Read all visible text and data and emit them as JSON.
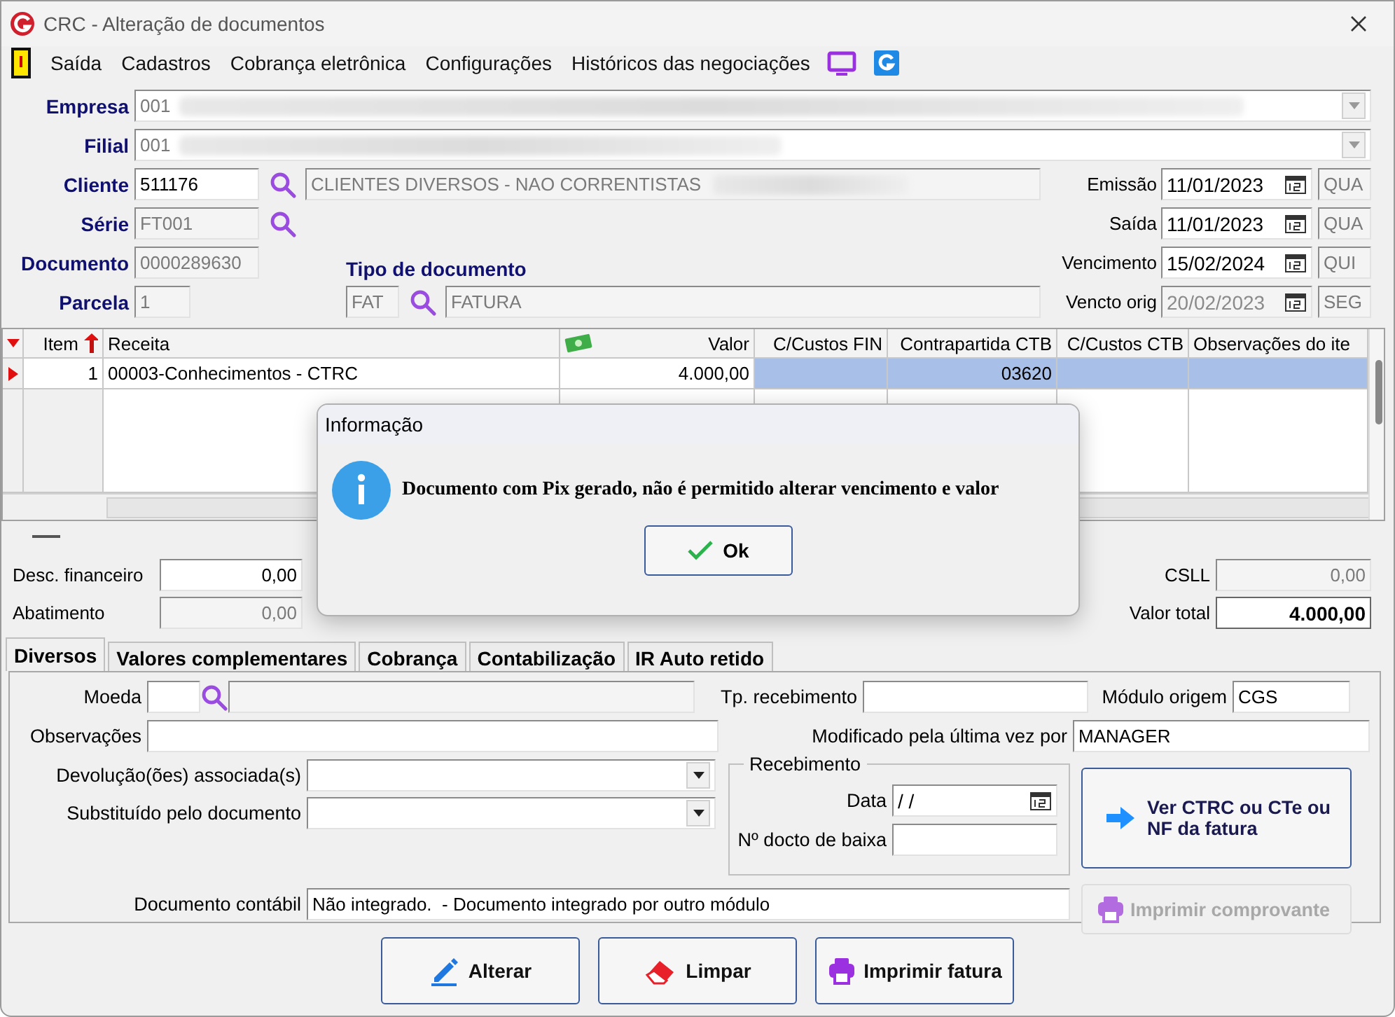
{
  "window": {
    "title": "CRC - Alteração de documentos"
  },
  "menu": [
    {
      "label": "Saída"
    },
    {
      "label": "Cadastros"
    },
    {
      "label": "Cobrança eletrônica"
    },
    {
      "label": "Configurações"
    },
    {
      "label": "Históricos das negociações"
    }
  ],
  "empresa": {
    "label": "Empresa",
    "value": "001"
  },
  "filial": {
    "label": "Filial",
    "value": "001"
  },
  "cliente": {
    "label": "Cliente",
    "code": "511176",
    "name": "CLIENTES DIVERSOS - NAO CORRENTISTAS"
  },
  "serie": {
    "label": "Série",
    "value": "FT001",
    "disabled": true
  },
  "documento": {
    "label": "Documento",
    "value": "0000289630",
    "disabled": true
  },
  "parcela": {
    "label": "Parcela",
    "value": "1",
    "disabled": true
  },
  "tipo_documento": {
    "label": "Tipo de documento",
    "code": "FAT",
    "name": "FATURA",
    "disabled": true
  },
  "dates": [
    {
      "label": "Emissão",
      "value": "11/01/2023",
      "weekday": "QUA",
      "disabled": false
    },
    {
      "label": "Saída",
      "value": "11/01/2023",
      "weekday": "QUA",
      "disabled": false
    },
    {
      "label": "Vencimento",
      "value": "15/02/2024",
      "weekday": "QUI",
      "disabled": false
    },
    {
      "label": "Vencto orig",
      "value": "20/02/2023",
      "weekday": "SEG",
      "disabled": true
    }
  ],
  "table": {
    "columns": [
      {
        "label": "Item",
        "kind": "sort"
      },
      {
        "label": "Receita",
        "kind": "plain"
      },
      {
        "label": "Valor",
        "kind": "money"
      },
      {
        "label": "C/Custos FIN",
        "kind": "plain"
      },
      {
        "label": "Contrapartida CTB",
        "kind": "plain"
      },
      {
        "label": "C/Custos CTB",
        "kind": "plain"
      },
      {
        "label": "Observações do ite",
        "kind": "plain"
      }
    ],
    "rows": [
      {
        "selected": true,
        "item": "1",
        "receita": "00003-Conhecimentos - CTRC",
        "valor": "4.000,00",
        "contrapartida": "03620"
      }
    ]
  },
  "totals": {
    "left": [
      {
        "label": "Desc. financeiro",
        "value": "0,00",
        "disabled": false
      },
      {
        "label": "Abatimento",
        "value": "0,00",
        "disabled": true
      }
    ],
    "right": [
      {
        "label": "CSLL",
        "value": "0,00",
        "disabled": true
      },
      {
        "label": "Valor total",
        "value": "4.000,00",
        "disabled": false
      }
    ]
  },
  "dialog": {
    "title": "Informação",
    "message": "Documento com Pix gerado, não é permitido alterar vencimento e valor",
    "button": "Ok"
  },
  "tabs": [
    {
      "label": "Diversos",
      "selected": true
    },
    {
      "label": "Valores complementares",
      "selected": false
    },
    {
      "label": "Cobrança",
      "selected": false
    },
    {
      "label": "Contabilização",
      "selected": false
    },
    {
      "label": "IR Auto retido",
      "selected": false
    }
  ],
  "diversos": {
    "moeda": {
      "label": "Moeda"
    },
    "tp_recebimento": {
      "label": "Tp. recebimento"
    },
    "modulo_origem": {
      "label": "Módulo origem",
      "value": "CGS"
    },
    "observacoes": {
      "label": "Observações"
    },
    "modificado_por": {
      "label": "Modificado pela última vez por",
      "value": "MANAGER"
    },
    "devolucoes": {
      "label": "Devolução(ões) associada(s)"
    },
    "substituido": {
      "label": "Substituído pelo documento"
    },
    "recebimento": {
      "title": "Recebimento",
      "data_label": "Data",
      "data_value": "/ /",
      "docto_label": "Nº docto de baixa"
    },
    "documento_contabil": {
      "label": "Documento contábil",
      "value": "Não integrado.  - Documento integrado por outro módulo"
    },
    "actions": [
      {
        "label": "Ver CTRC ou CTe ou NF da fatura",
        "disabled": false
      },
      {
        "label": "Imprimir comprovante",
        "disabled": true
      }
    ]
  },
  "buttons": [
    {
      "label": "Alterar"
    },
    {
      "label": "Limpar"
    },
    {
      "label": "Imprimir fatura"
    }
  ]
}
